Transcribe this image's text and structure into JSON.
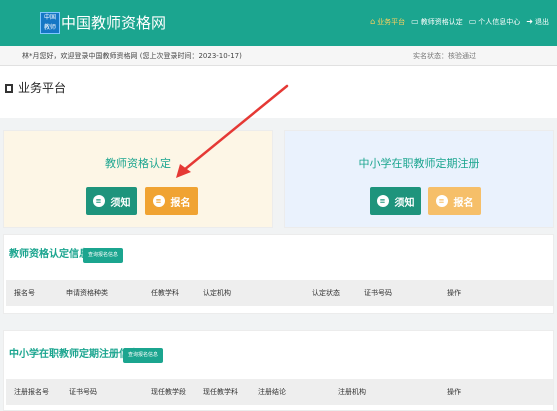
{
  "header": {
    "logo_text_line1": "中国",
    "logo_text_line2": "教师",
    "site_title": "中国教师资格网",
    "nav": [
      {
        "label": "业务平台",
        "icon": "home-icon",
        "active": true
      },
      {
        "label": "教师资格认定",
        "icon": "monitor-icon",
        "active": false
      },
      {
        "label": "个人信息中心",
        "icon": "monitor-icon",
        "active": false
      },
      {
        "label": "退出",
        "icon": "logout-icon",
        "active": false
      }
    ]
  },
  "welcome": {
    "message": "林*月您好，欢迎登录中国教师资格网 (您上次登录时间：2023-10-17)",
    "realname_status": "实名状态：核验通过"
  },
  "page": {
    "title": "业务平台",
    "icon": "notebook-icon"
  },
  "cards": {
    "left": {
      "title": "教师资格认定",
      "notice_label": "须知",
      "register_label": "报名"
    },
    "right": {
      "title": "中小学在职教师定期注册",
      "notice_label": "须知",
      "register_label": "报名"
    }
  },
  "panel_cert": {
    "title": "教师资格认定信息",
    "query_button": "查询报名信息",
    "columns": [
      "报名号",
      "申请资格种类",
      "任教学科",
      "认定机构",
      "认定状态",
      "证书号码",
      "操作"
    ]
  },
  "panel_register": {
    "title": "中小学在职教师定期注册信息",
    "query_button": "查询报名信息",
    "columns": [
      "注册报名号",
      "证书号码",
      "现任教学段",
      "现任教学科",
      "注册结论",
      "注册机构",
      "操作"
    ]
  },
  "colors": {
    "brand_green": "#1ba58f",
    "button_green": "#1e947c",
    "button_orange": "#f0a332",
    "annotation_arrow": "#e53935"
  }
}
